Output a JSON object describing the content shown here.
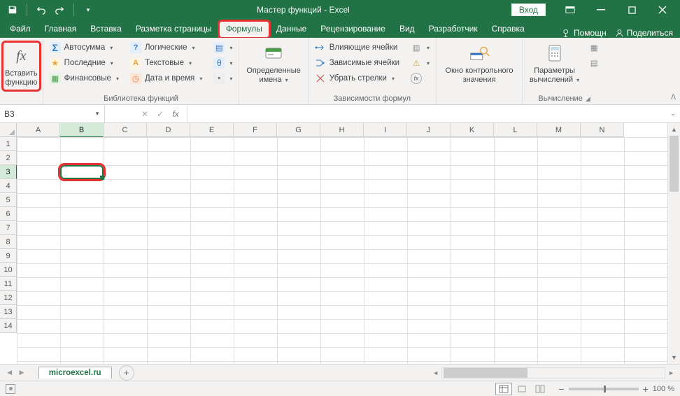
{
  "title": "Мастер функций  -  Excel",
  "login": "Вход",
  "tabs": {
    "file": "Файл",
    "items": [
      "Главная",
      "Вставка",
      "Разметка страницы",
      "Формулы",
      "Данные",
      "Рецензирование",
      "Вид",
      "Разработчик",
      "Справка"
    ],
    "active_index": 3,
    "help": "Помощн",
    "share": "Поделиться"
  },
  "ribbon": {
    "insert_fn_top": "Вставить",
    "insert_fn_bottom": "функцию",
    "lib": {
      "autosum": "Автосумма",
      "recent": "Последние",
      "financial": "Финансовые",
      "logical": "Логические",
      "text": "Текстовые",
      "datetime": "Дата и время",
      "group": "Библиотека функций"
    },
    "defnames": {
      "top": "Определенные",
      "bottom": "имена"
    },
    "deps": {
      "precedents": "Влияющие ячейки",
      "dependents": "Зависимые ячейки",
      "remove": "Убрать стрелки",
      "group": "Зависимости формул"
    },
    "watch": {
      "top": "Окно контрольного",
      "bottom": "значения"
    },
    "calc": {
      "top": "Параметры",
      "bottom": "вычислений",
      "group": "Вычисление"
    }
  },
  "namebox": "B3",
  "sheet": "microexcel.ru",
  "columns": [
    "A",
    "B",
    "C",
    "D",
    "E",
    "F",
    "G",
    "H",
    "I",
    "J",
    "K",
    "L",
    "M",
    "N"
  ],
  "rows": [
    "1",
    "2",
    "3",
    "4",
    "5",
    "6",
    "7",
    "8",
    "9",
    "10",
    "11",
    "12",
    "13",
    "14"
  ],
  "active": {
    "col": 1,
    "row": 2
  },
  "zoom": "100 %"
}
